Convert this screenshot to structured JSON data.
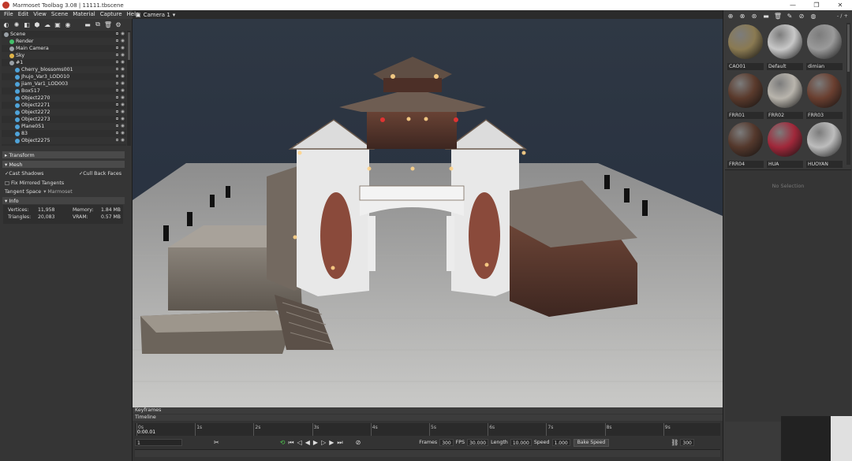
{
  "window": {
    "title": "Marmoset Toolbag 3.08  |  11111.tbscene",
    "minimize": "—",
    "maximize": "❐",
    "close": "✕"
  },
  "menu": [
    "File",
    "Edit",
    "View",
    "Scene",
    "Material",
    "Capture",
    "Help"
  ],
  "viewport": {
    "camera_label": "Camera 1",
    "camera_dropdown": "▾"
  },
  "scene_tree": [
    {
      "label": "Scene",
      "indent": 0,
      "color": "#9aa0a6"
    },
    {
      "label": "Render",
      "indent": 1,
      "color": "#43c06b"
    },
    {
      "label": "Main Camera",
      "indent": 1,
      "color": "#9aa0a6"
    },
    {
      "label": "Sky",
      "indent": 1,
      "color": "#e0b448"
    },
    {
      "label": "#1",
      "indent": 1,
      "color": "#9aa0a6"
    },
    {
      "label": "Cherry_blossoms001",
      "indent": 2,
      "color": "#4fa3d9"
    },
    {
      "label": "Jhujo_Var3_LOD010",
      "indent": 2,
      "color": "#4fa3d9"
    },
    {
      "label": "jiam_Var1_LOD003",
      "indent": 2,
      "color": "#4fa3d9"
    },
    {
      "label": "Box517",
      "indent": 2,
      "color": "#4fa3d9"
    },
    {
      "label": "Object2270",
      "indent": 2,
      "color": "#4fa3d9"
    },
    {
      "label": "Object2271",
      "indent": 2,
      "color": "#4fa3d9"
    },
    {
      "label": "Object2272",
      "indent": 2,
      "color": "#4fa3d9"
    },
    {
      "label": "Object2273",
      "indent": 2,
      "color": "#4fa3d9"
    },
    {
      "label": "Plane051",
      "indent": 2,
      "color": "#4fa3d9"
    },
    {
      "label": "83",
      "indent": 2,
      "color": "#4fa3d9"
    },
    {
      "label": "Object2275",
      "indent": 2,
      "color": "#4fa3d9"
    }
  ],
  "properties": {
    "transform_header": "Transform",
    "mesh_header": "Mesh",
    "cast_shadows": "Cast Shadows",
    "cull_back_faces": "Cull Back Faces",
    "fix_mirrored": "Fix Mirrored Tangents",
    "tangent_space_label": "Tangent Space",
    "tangent_space_value": "Marmoset",
    "info_header": "Info",
    "vertices_label": "Vertices:",
    "vertices_value": "11,958",
    "triangles_label": "Triangles:",
    "triangles_value": "20,083",
    "memory_label": "Memory:",
    "memory_value": "1.84 MB",
    "vram_label": "VRAM:",
    "vram_value": "0.57 MB"
  },
  "materials": {
    "zoom_label": "- / +",
    "no_selection": "No Selection",
    "items": [
      {
        "name": "CAO01",
        "color": "#8a7a52"
      },
      {
        "name": "Default",
        "color": "#c8c8c8"
      },
      {
        "name": "dimian",
        "color": "#9a9a9a"
      },
      {
        "name": "FRR01",
        "color": "#5a3a2c"
      },
      {
        "name": "FRR02",
        "color": "#b9b5ad"
      },
      {
        "name": "FRR03",
        "color": "#6a3f30"
      },
      {
        "name": "FRR04",
        "color": "#54382c"
      },
      {
        "name": "HUA",
        "color": "#a0283a"
      },
      {
        "name": "HUOYAN",
        "color": "#bdbdbd"
      }
    ]
  },
  "timeline": {
    "keyframes_label": "Keyframes",
    "timeline_label": "Timeline",
    "current_time": "0:00.01",
    "ticks": [
      "0s",
      "1s",
      "2s",
      "3s",
      "4s",
      "5s",
      "6s",
      "7s",
      "8s",
      "9s"
    ],
    "frame_field": "1",
    "frames_label": "Frames",
    "frames_value": "300",
    "fps_label": "FPS",
    "fps_value": "30.000",
    "length_label": "Length",
    "length_value": "10.000",
    "speed_label": "Speed",
    "speed_value": "1.000",
    "bake_speed": "Bake Speed",
    "end_frame": "300"
  }
}
